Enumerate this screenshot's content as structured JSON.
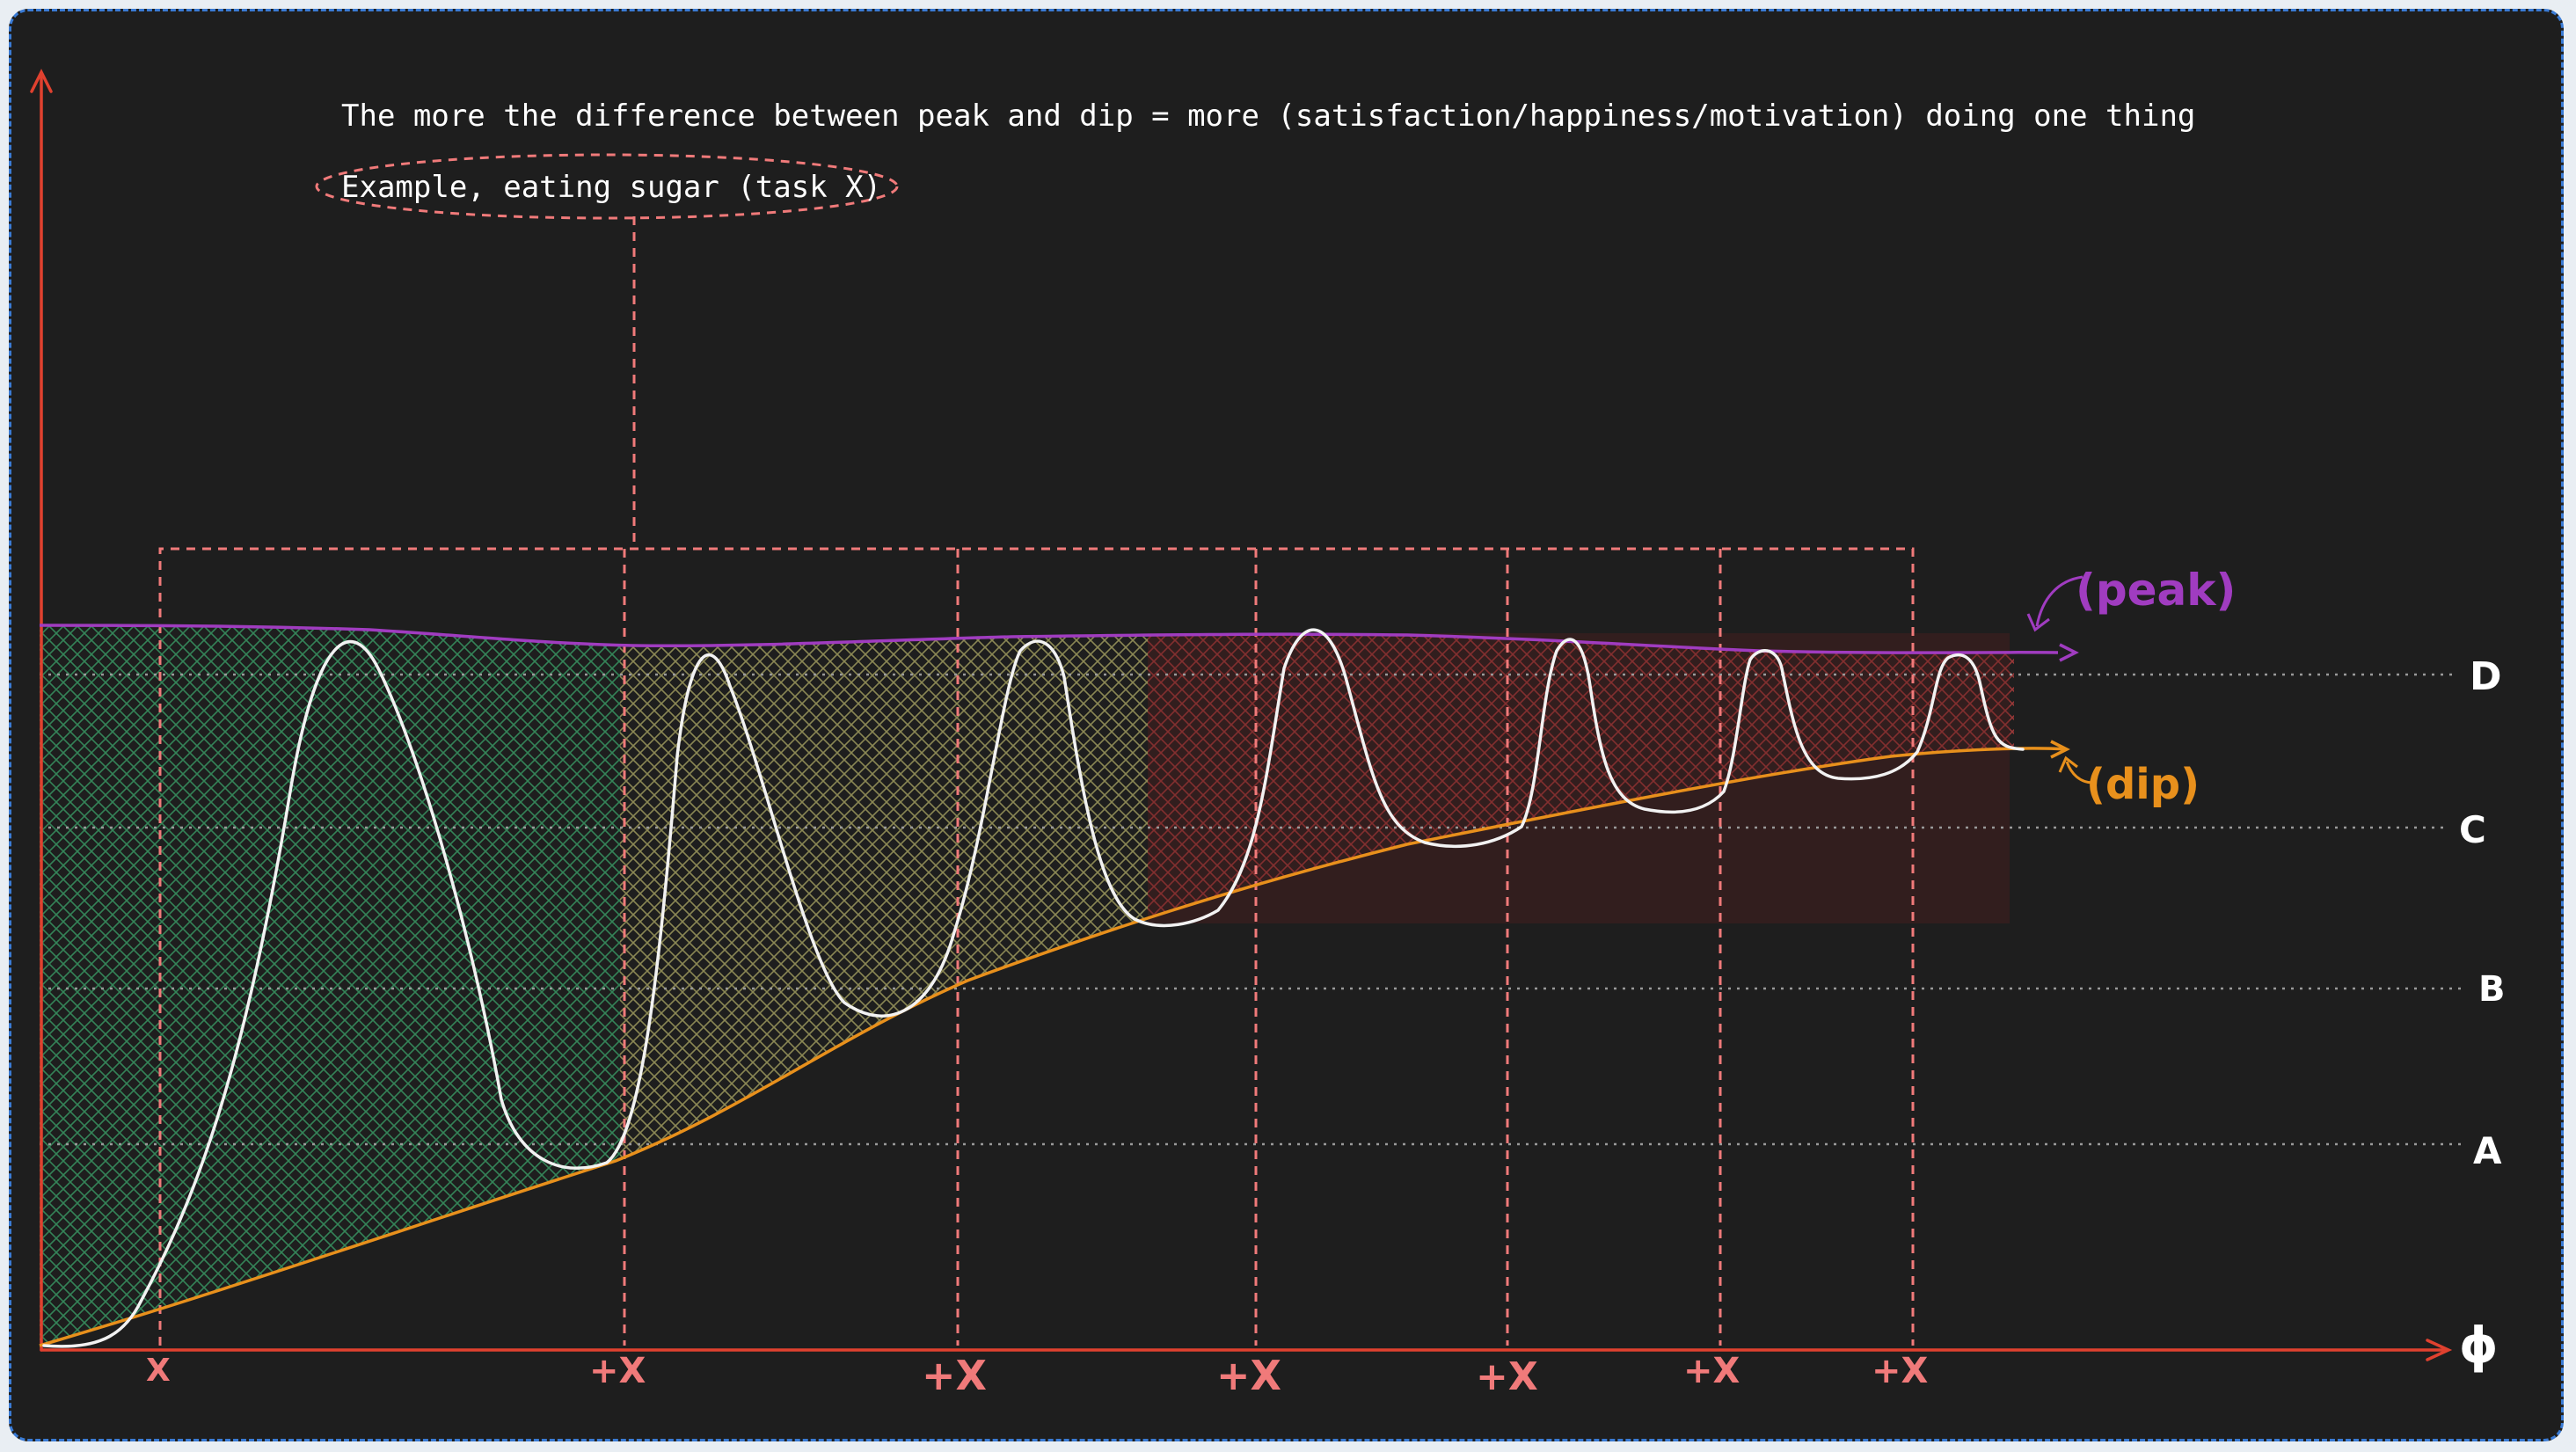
{
  "caption": {
    "headline": "The more the difference between peak and dip = more (satisfaction/happiness/motivation) doing one thing",
    "example": "Example, eating sugar (task X)"
  },
  "levels": {
    "d": "D",
    "c": "C",
    "b": "B",
    "a": "A",
    "origin": "ϕ"
  },
  "curves": {
    "peak": "(peak)",
    "dip": "(dip)"
  },
  "events": [
    "X",
    "+X",
    "+X",
    "+X",
    "+X",
    "+X",
    "+X"
  ],
  "colors": {
    "background": "#1e1e1e",
    "axis": "#e0412f",
    "peak": "#a03cc0",
    "dip": "#e8901c",
    "curve": "#f2f2f2",
    "marker": "#f07a7a",
    "zone_green": "#2e8b57",
    "zone_yellow": "#9c9c5a",
    "zone_red": "#8e2a2a",
    "gridline": "#9a9a9a"
  }
}
